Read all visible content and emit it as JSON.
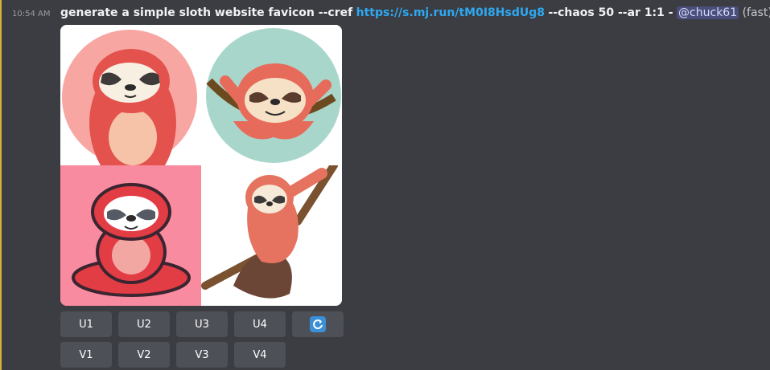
{
  "message": {
    "timestamp": "10:54 AM",
    "prompt": "generate a simple sloth website favicon --cref",
    "link": "https://s.mj.run/tM0I8HsdUg8",
    "params": "--chaos 50 --ar 1:1 -",
    "mention": "@chuck61",
    "speed": "(fast)"
  },
  "buttons": {
    "upscale": [
      "U1",
      "U2",
      "U3",
      "U4"
    ],
    "variation": [
      "V1",
      "V2",
      "V3",
      "V4"
    ],
    "reroll_icon": "refresh-icon"
  },
  "colors": {
    "background": "#3b3d42",
    "accent": "#d8b23a",
    "link": "#2ea8f0",
    "button": "#4e5058",
    "reroll": "#3a8fd6"
  }
}
